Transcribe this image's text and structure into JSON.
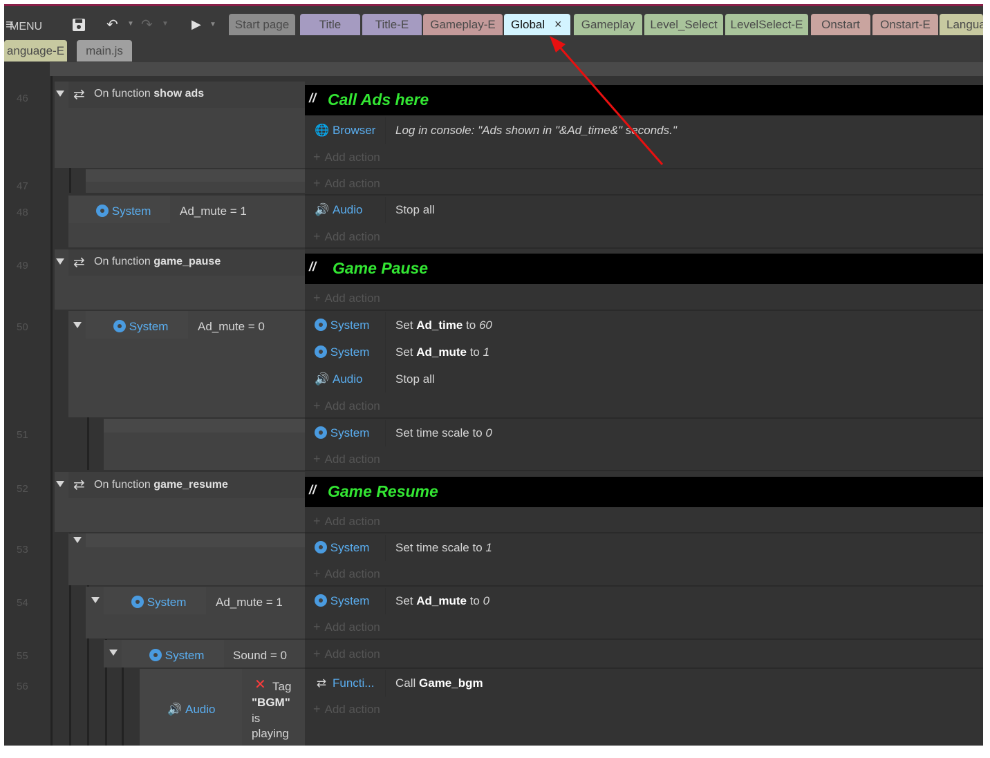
{
  "toolbar": {
    "menu_label": "MENU",
    "tabs": [
      "Start page",
      "Title",
      "Title-E",
      "Gameplay-E",
      "Global",
      "Gameplay",
      "Level_Select",
      "LevelSelect-E",
      "Onstart",
      "Onstart-E",
      "Langua"
    ],
    "active_close": "×",
    "tabs_row2": [
      "anguage-E",
      "main.js"
    ],
    "colors": {
      "title_bar": "#8a1f48",
      "active_tab": "#d3f4ff",
      "comment_text": "#33e633",
      "object_text": "#5aaef0",
      "arrow": "#e81010"
    }
  },
  "lines": [
    "46",
    "47",
    "48",
    "49",
    "50",
    "51",
    "52",
    "53",
    "54",
    "55",
    "56"
  ],
  "events": {
    "e46": {
      "title_pre": "On function ",
      "title_bold": "show ads",
      "comment": "Call Ads here",
      "act_obj": "Browser",
      "act_desc": "Log in console: \"Ads shown in \"&Ad_time&\" seconds.\""
    },
    "e48": {
      "cond_obj": "System",
      "cond_exp": "Ad_mute = 1",
      "act_obj": "Audio",
      "act_desc": "Stop all"
    },
    "e49": {
      "title_pre": "On function ",
      "title_bold": "game_pause",
      "comment": "Game Pause"
    },
    "e50": {
      "cond_obj": "System",
      "cond_exp": "Ad_mute = 0",
      "a1_obj": "System",
      "a1_pre": "Set ",
      "a1_bold": "Ad_time",
      "a1_mid": " to ",
      "a1_val": "60",
      "a2_obj": "System",
      "a2_pre": "Set ",
      "a2_bold": "Ad_mute",
      "a2_mid": " to ",
      "a2_val": "1",
      "a3_obj": "Audio",
      "a3_desc": "Stop all"
    },
    "e51": {
      "act_obj": "System",
      "act_pre": "Set time scale to ",
      "act_val": "0"
    },
    "e52": {
      "title_pre": "On function ",
      "title_bold": "game_resume",
      "comment": "Game Resume"
    },
    "e53": {
      "act_obj": "System",
      "act_pre": "Set time scale to ",
      "act_val": "1"
    },
    "e54": {
      "cond_obj": "System",
      "cond_exp": "Ad_mute = 1",
      "act_obj": "System",
      "act_pre": "Set ",
      "act_bold": "Ad_mute",
      "act_mid": " to ",
      "act_val": "0"
    },
    "e55": {
      "cond_obj": "System",
      "cond_exp": "Sound = 0"
    },
    "e56": {
      "cond_obj": "Audio",
      "cond_x": "✕",
      "cond_tag": "Tag",
      "cond_name": "\"BGM\"",
      "cond_is": "is",
      "cond_playing": "playing",
      "act_obj": "Functi...",
      "act_pre": "Call ",
      "act_bold": "Game_bgm"
    }
  },
  "add_action": "Add action",
  "comment_mark": "//"
}
